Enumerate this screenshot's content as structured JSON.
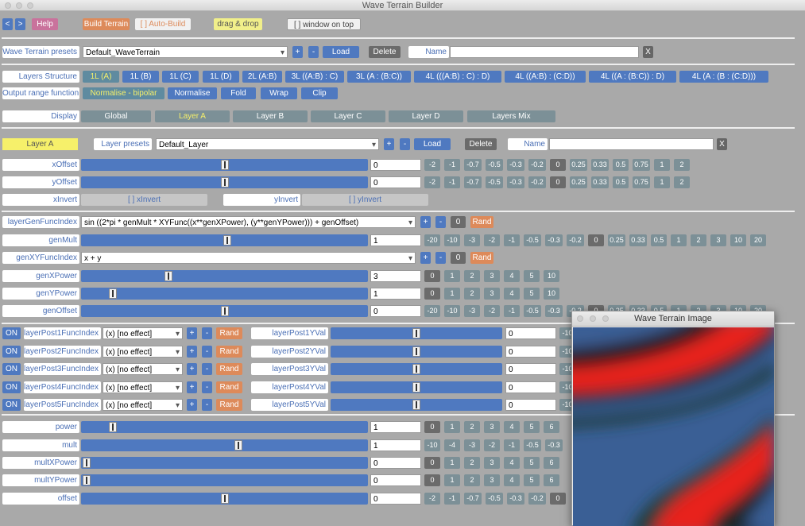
{
  "window": {
    "title": "Wave Terrain Builder"
  },
  "toolbar": {
    "prev": "<",
    "next": ">",
    "help": "Help",
    "build": "Build Terrain",
    "autobuild": "[ ] Auto-Build",
    "dragdrop": "drag & drop",
    "window_on_top": "[ ] window on top"
  },
  "presets": {
    "label": "Wave Terrain presets",
    "value": "Default_WaveTerrain",
    "plus": "+",
    "minus": "-",
    "load": "Load",
    "delete": "Delete",
    "name_label": "Name",
    "name_value": "",
    "close": "X"
  },
  "structure": {
    "label": "Layers Structure",
    "options": [
      "1L (A)",
      "1L (B)",
      "1L (C)",
      "1L (D)",
      "2L (A:B)",
      "3L ((A:B) : C)",
      "3L (A : (B:C))",
      "4L (((A:B) : C) : D)",
      "4L ((A:B) : (C:D))",
      "4L ((A : (B:C)) : D)",
      "4L (A : (B : (C:D)))"
    ],
    "selected": 0
  },
  "output": {
    "label": "Output range function",
    "options": [
      "Normalise - bipolar",
      "Normalise",
      "Fold",
      "Wrap",
      "Clip"
    ],
    "selected": 0
  },
  "display": {
    "label": "Display",
    "options": [
      "Global",
      "Layer A",
      "Layer B",
      "Layer C",
      "Layer D",
      "Layers Mix"
    ],
    "selected": 1
  },
  "layer": {
    "name": "Layer A",
    "presets_label": "Layer presets",
    "presets_value": "Default_Layer",
    "plus": "+",
    "minus": "-",
    "load": "Load",
    "delete": "Delete",
    "name_label": "Name",
    "name_value": "",
    "close": "X"
  },
  "offset_buttons": [
    "-2",
    "-1",
    "-0.7",
    "-0.5",
    "-0.3",
    "-0.2",
    "0",
    "0.25",
    "0.33",
    "0.5",
    "0.75",
    "1",
    "2"
  ],
  "xOffset": {
    "label": "xOffset",
    "value": "0",
    "level": 0.5
  },
  "yOffset": {
    "label": "yOffset",
    "value": "0",
    "level": 0.5
  },
  "xInvert": {
    "label": "xInvert",
    "toggle": "[ ] xInvert"
  },
  "yInvert": {
    "label": "yInvert",
    "toggle": "[ ] yInvert"
  },
  "genFunc": {
    "label": "layerGenFuncIndex",
    "value": "sin ((2*pi * genMult * XYFunc((x**genXPower), (y**genYPower))) + genOffset)",
    "plus": "+",
    "minus": "-",
    "zero": "0",
    "rand": "Rand"
  },
  "mult_buttons": [
    "-20",
    "-10",
    "-3",
    "-2",
    "-1",
    "-0.5",
    "-0.3",
    "-0.2",
    "0",
    "0.25",
    "0.33",
    "0.5",
    "1",
    "2",
    "3",
    "10",
    "20"
  ],
  "genMult": {
    "label": "genMult",
    "value": "1",
    "level": 0.51
  },
  "genXYFunc": {
    "label": "genXYFuncIndex",
    "value": "x + y",
    "plus": "+",
    "minus": "-",
    "zero": "0",
    "rand": "Rand"
  },
  "power_buttons": [
    "0",
    "1",
    "2",
    "3",
    "4",
    "5",
    "10"
  ],
  "genXPower": {
    "label": "genXPower",
    "value": "3",
    "level": 0.3
  },
  "genYPower": {
    "label": "genYPower",
    "value": "1",
    "level": 0.1
  },
  "genOffset": {
    "label": "genOffset",
    "value": "0",
    "level": 0.5
  },
  "post": [
    {
      "on": "ON",
      "label": "layerPost1FuncIndex",
      "func": "(x) [no effect]",
      "plus": "+",
      "minus": "-",
      "rand": "Rand",
      "yval_label": "layerPost1YVal",
      "yval": "0",
      "level": 0.5
    },
    {
      "on": "ON",
      "label": "layerPost2FuncIndex",
      "func": "(x) [no effect]",
      "plus": "+",
      "minus": "-",
      "rand": "Rand",
      "yval_label": "layerPost2YVal",
      "yval": "0",
      "level": 0.5
    },
    {
      "on": "ON",
      "label": "layerPost3FuncIndex",
      "func": "(x) [no effect]",
      "plus": "+",
      "minus": "-",
      "rand": "Rand",
      "yval_label": "layerPost3YVal",
      "yval": "0",
      "level": 0.5
    },
    {
      "on": "ON",
      "label": "layerPost4FuncIndex",
      "func": "(x) [no effect]",
      "plus": "+",
      "minus": "-",
      "rand": "Rand",
      "yval_label": "layerPost4YVal",
      "yval": "0",
      "level": 0.5
    },
    {
      "on": "ON",
      "label": "layerPost5FuncIndex",
      "func": "(x) [no effect]",
      "plus": "+",
      "minus": "-",
      "rand": "Rand",
      "yval_label": "layerPost5YVal",
      "yval": "0",
      "level": 0.5
    }
  ],
  "post_btn_text": "-10",
  "global_power_buttons": [
    "0",
    "1",
    "2",
    "3",
    "4",
    "5",
    "6"
  ],
  "power": {
    "label": "power",
    "value": "1",
    "level": 0.1
  },
  "mult": {
    "label": "mult",
    "value": "1",
    "level": 0.55
  },
  "mult_buttons2": [
    "-10",
    "-4",
    "-3",
    "-2",
    "-1",
    "-0.5",
    "-0.3"
  ],
  "multXPower": {
    "label": "multXPower",
    "value": "0",
    "level": 0.0
  },
  "multYPower": {
    "label": "multYPower",
    "value": "0",
    "level": 0.0
  },
  "offset": {
    "label": "offset",
    "value": "0",
    "level": 0.5
  },
  "offset_buttons2": [
    "-2",
    "-1",
    "-0.7",
    "-0.5",
    "-0.3",
    "-0.2",
    "0"
  ],
  "image_window": {
    "title": "Wave Terrain Image"
  },
  "colors": {
    "accent": "#4f79c0",
    "rand": "#dd8a5a",
    "terrain_red": "#e8201c",
    "terrain_blue": "#3a5f95"
  }
}
